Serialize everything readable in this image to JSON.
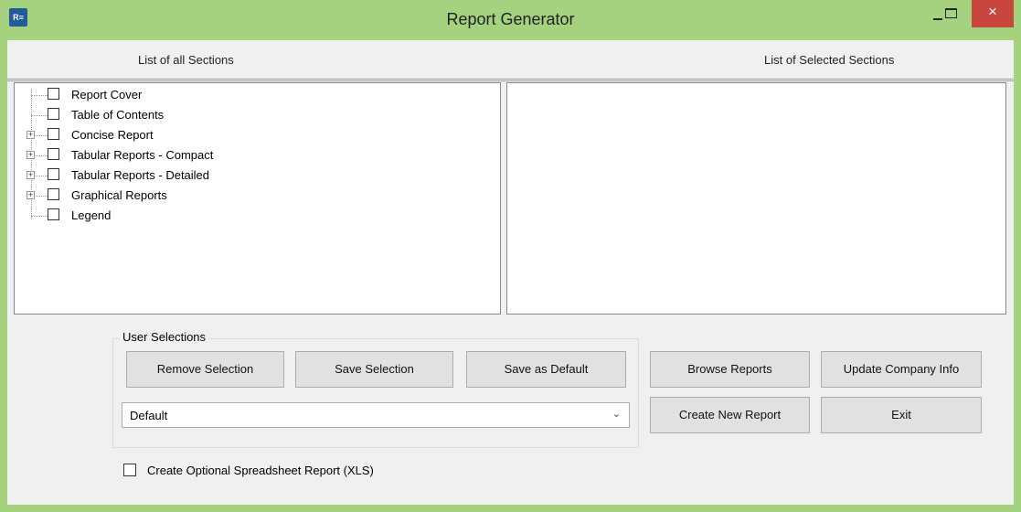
{
  "window": {
    "title": "Report Generator",
    "icon_name": "app-icon",
    "controls": {
      "minimize": "minimize-icon",
      "maximize": "maximize-icon",
      "close": "×"
    }
  },
  "sections_header": "List of all Sections",
  "selected_header": "List of Selected Sections",
  "sections": [
    {
      "label": "Report Cover",
      "expandable": false
    },
    {
      "label": "Table of Contents",
      "expandable": false
    },
    {
      "label": "Concise Report",
      "expandable": true
    },
    {
      "label": "Tabular Reports - Compact",
      "expandable": true
    },
    {
      "label": "Tabular Reports - Detailed",
      "expandable": true
    },
    {
      "label": "Graphical Reports",
      "expandable": true
    },
    {
      "label": "Legend",
      "expandable": false
    }
  ],
  "user_selections": {
    "title": "User Selections",
    "remove_label": "Remove Selection",
    "save_label": "Save Selection",
    "save_default_label": "Save as Default",
    "selected_option": "Default"
  },
  "actions": {
    "browse_label": "Browse Reports",
    "update_label": "Update Company Info",
    "create_label": "Create New Report",
    "exit_label": "Exit"
  },
  "xls_option_label": "Create Optional Spreadsheet Report (XLS)",
  "colors": {
    "frame": "#a4d27e",
    "close_button": "#c9463e",
    "panel": "#f0f0f0"
  }
}
